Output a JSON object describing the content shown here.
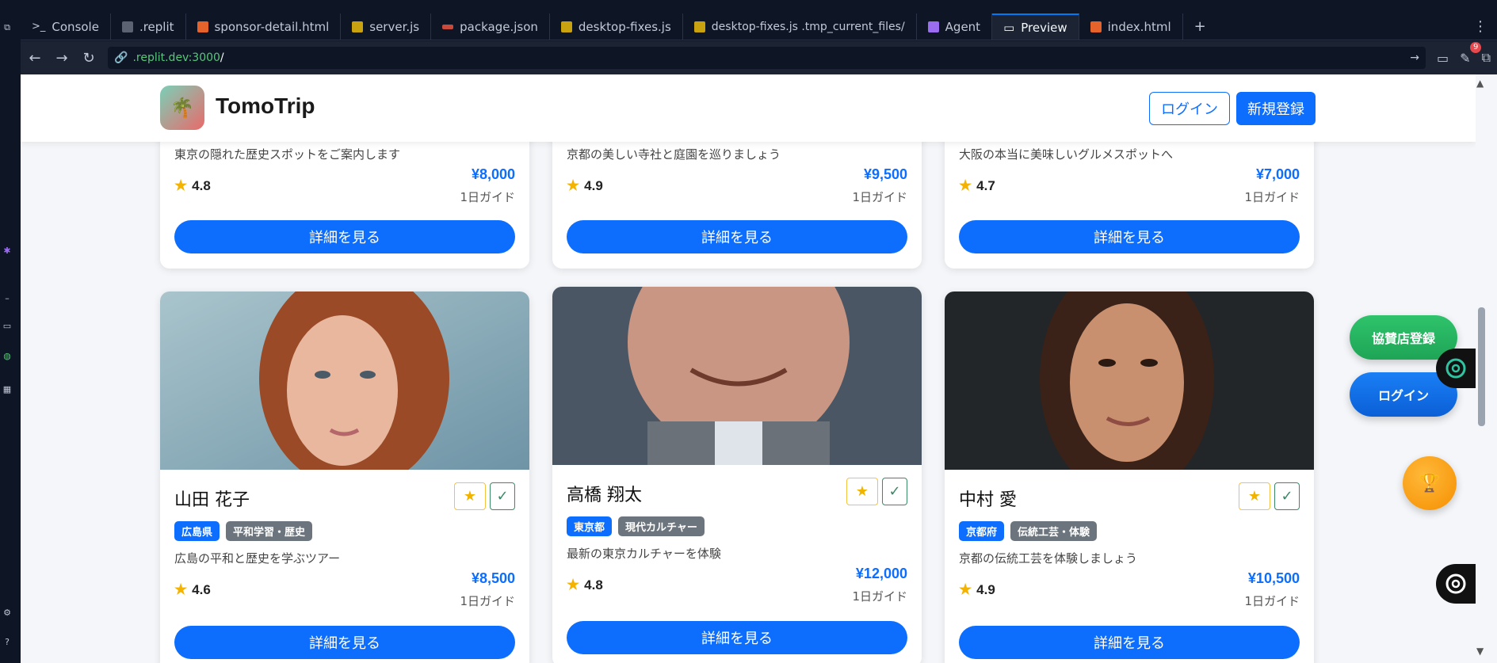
{
  "ide": {
    "tabs": [
      {
        "label": "Console",
        "icon": "console-icon",
        "color": "#c2c8d6"
      },
      {
        "label": ".replit",
        "icon": "replit-file-icon",
        "color": "#8a93a5"
      },
      {
        "label": "sponsor-detail.html",
        "icon": "html-icon",
        "color": "#e5622b"
      },
      {
        "label": "server.js",
        "icon": "js-icon",
        "color": "#c9a30f"
      },
      {
        "label": "package.json",
        "icon": "json-icon",
        "color": "#c94a3a"
      },
      {
        "label": "desktop-fixes.js",
        "icon": "js-icon",
        "color": "#c9a30f"
      },
      {
        "label": "desktop-fixes.js .tmp_current_files/",
        "icon": "js-icon",
        "color": "#c9a30f"
      },
      {
        "label": "Agent",
        "icon": "agent-icon",
        "color": "#9a6cf0"
      },
      {
        "label": "Preview",
        "icon": "preview-icon",
        "color": "#c2c8d6",
        "active": true
      },
      {
        "label": "index.html",
        "icon": "html-icon",
        "color": "#e5622b"
      }
    ],
    "url_host": ".replit.dev:3000",
    "url_path": "/",
    "notification_count": "9"
  },
  "header": {
    "brand": "TomoTrip",
    "login": "ログイン",
    "register": "新規登録"
  },
  "cards_top": [
    {
      "desc": "東京の隠れた歴史スポットをご案内します",
      "rating": "4.8",
      "price": "¥8,000",
      "unit": "1日ガイド",
      "button": "詳細を見る"
    },
    {
      "desc": "京都の美しい寺社と庭園を巡りましょう",
      "rating": "4.9",
      "price": "¥9,500",
      "unit": "1日ガイド",
      "button": "詳細を見る"
    },
    {
      "desc": "大阪の本当に美味しいグルメスポットへ",
      "rating": "4.7",
      "price": "¥7,000",
      "unit": "1日ガイド",
      "button": "詳細を見る"
    }
  ],
  "cards_bottom": [
    {
      "name": "山田 花子",
      "tag1": "広島県",
      "tag2": "平和学習・歴史",
      "desc": "広島の平和と歴史を学ぶツアー",
      "rating": "4.6",
      "price": "¥8,500",
      "unit": "1日ガイド",
      "button": "詳細を見る"
    },
    {
      "name": "高橋 翔太",
      "tag1": "東京都",
      "tag2": "現代カルチャー",
      "desc": "最新の東京カルチャーを体験",
      "rating": "4.8",
      "price": "¥12,000",
      "unit": "1日ガイド",
      "button": "詳細を見る"
    },
    {
      "name": "中村 愛",
      "tag1": "京都府",
      "tag2": "伝統工芸・体験",
      "desc": "京都の伝統工芸を体験しましょう",
      "rating": "4.9",
      "price": "¥10,500",
      "unit": "1日ガイド",
      "button": "詳細を見る"
    }
  ],
  "floating": {
    "sponsor": "協賛店登録",
    "login": "ログイン"
  },
  "symbols": {
    "star": "★",
    "check": "✓"
  },
  "colors": {
    "primary": "#0d6efd",
    "sponsor_green": "#22b45f",
    "orange": "#f59a00"
  }
}
